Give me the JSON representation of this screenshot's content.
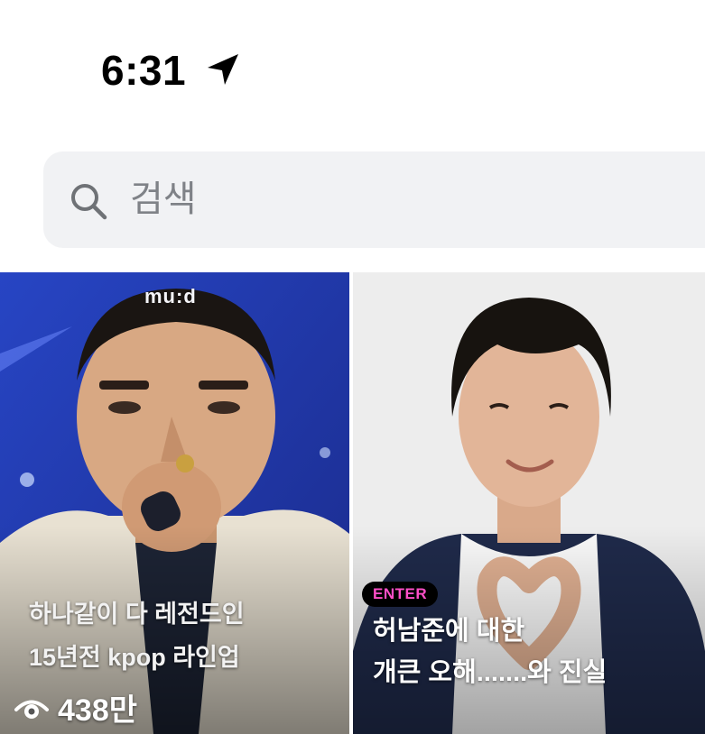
{
  "status_bar": {
    "time": "6:31",
    "location_icon": "location-arrow-icon"
  },
  "search": {
    "placeholder": "검색",
    "icon": "search-icon"
  },
  "feed": {
    "cards": [
      {
        "watermark": "mu:d",
        "caption_line1": "하나같이 다 레전드인",
        "caption_line2": "15년전 kpop 라인업",
        "view_count": "438만",
        "icon": "eye-icon"
      },
      {
        "badge": "ENTER",
        "caption_line1": "허남준에 대한",
        "caption_line2": "개큰 오해.......와 진실"
      }
    ]
  },
  "colors": {
    "badge_text": "#ff4fc8",
    "search_bg": "#f1f2f4",
    "placeholder": "#7f8287"
  }
}
